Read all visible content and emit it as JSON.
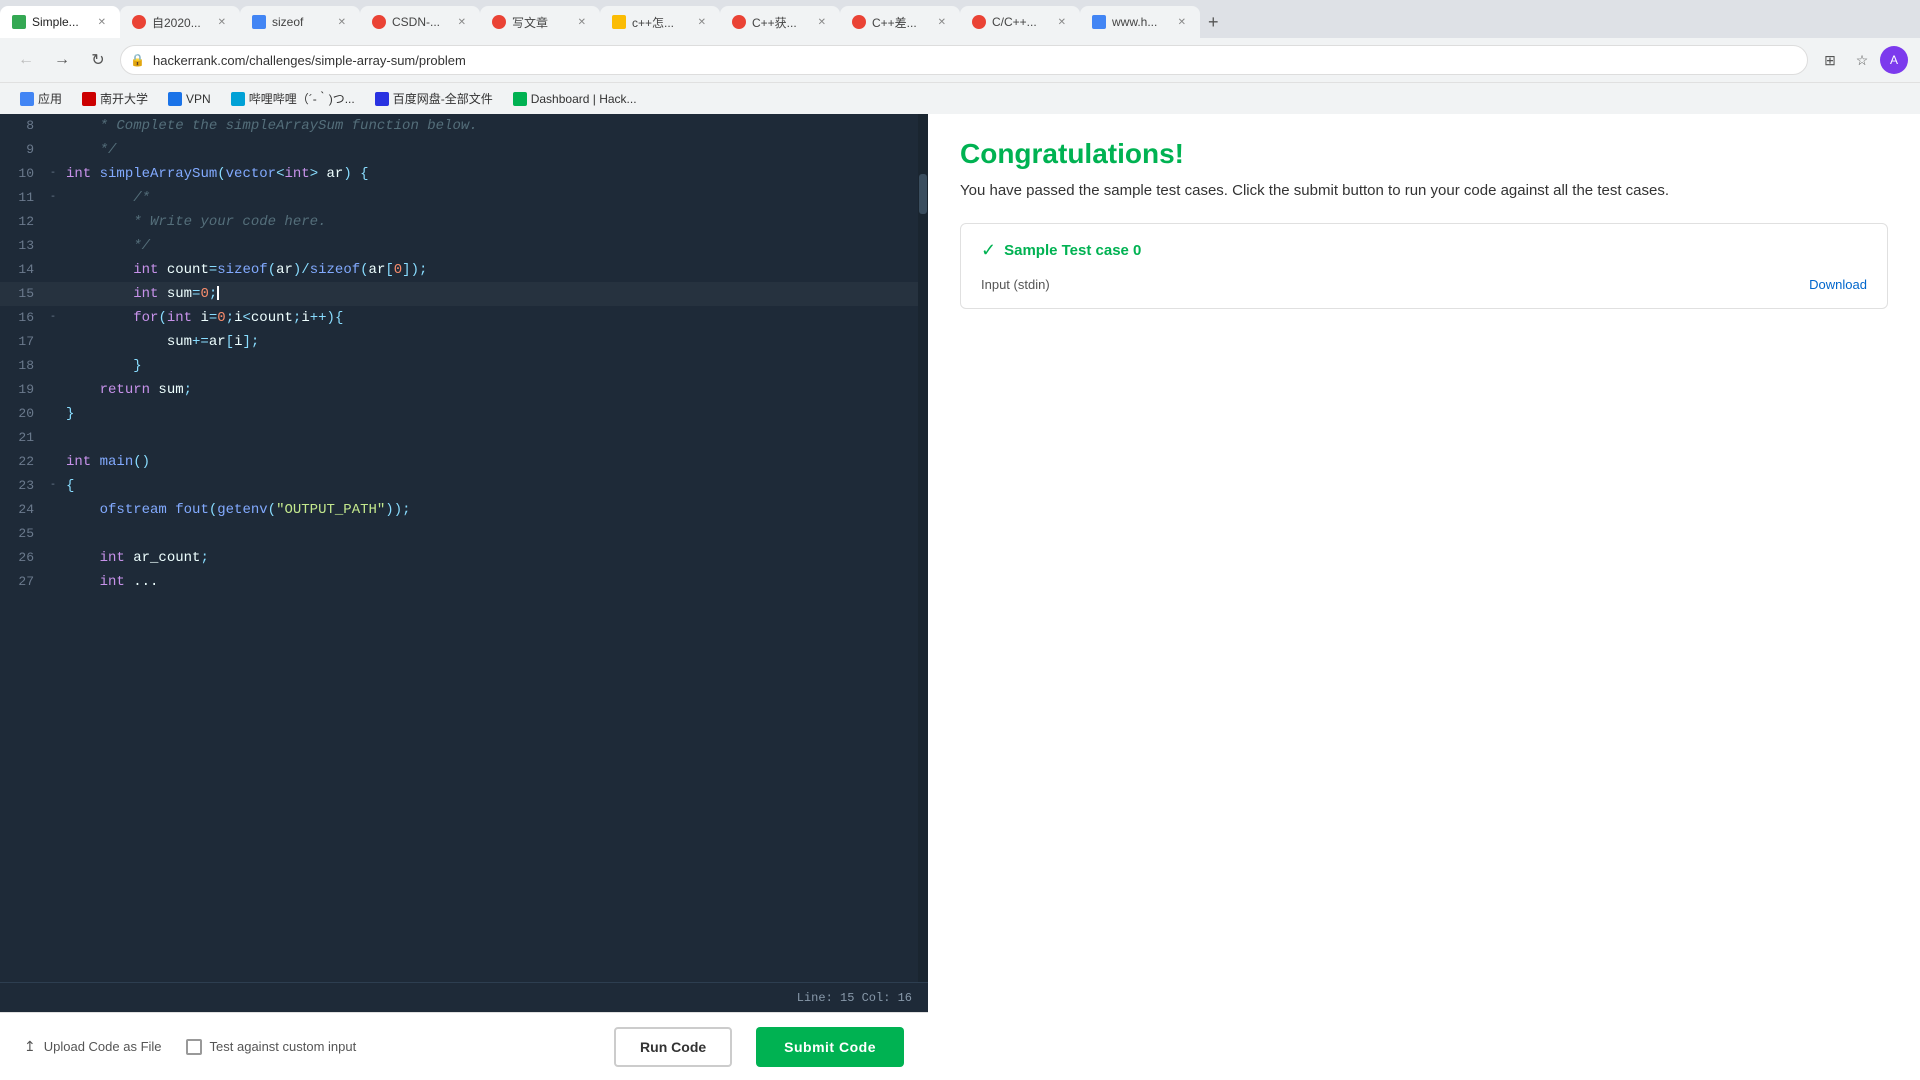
{
  "browser": {
    "tabs": [
      {
        "id": "t1",
        "title": "Simple...",
        "favicon_class": "green",
        "active": true
      },
      {
        "id": "t2",
        "title": "自2020...",
        "favicon_class": "red-c",
        "active": false
      },
      {
        "id": "t3",
        "title": "sizeof",
        "favicon_class": "blue-b",
        "active": false
      },
      {
        "id": "t4",
        "title": "CSDN-...",
        "favicon_class": "red-c",
        "active": false
      },
      {
        "id": "t5",
        "title": "写文章",
        "favicon_class": "red-c",
        "active": false
      },
      {
        "id": "t6",
        "title": "c++怎...",
        "favicon_class": "yellow-b",
        "active": false
      },
      {
        "id": "t7",
        "title": "C++获...",
        "favicon_class": "red-c",
        "active": false
      },
      {
        "id": "t8",
        "title": "C++差...",
        "favicon_class": "red-c",
        "active": false
      },
      {
        "id": "t9",
        "title": "C/C++...",
        "favicon_class": "red-c",
        "active": false
      },
      {
        "id": "t10",
        "title": "www.h...",
        "favicon_class": "blue-b",
        "active": false
      }
    ],
    "address": "hackerrank.com/challenges/simple-array-sum/problem",
    "bookmarks": [
      {
        "label": "应用",
        "favicon_class": "bm-apps"
      },
      {
        "label": "南开大学",
        "favicon_class": "bm-nankai"
      },
      {
        "label": "VPN",
        "favicon_class": "bm-vpn"
      },
      {
        "label": "哔哩哔哩（´-｀)つ...",
        "favicon_class": "bm-bilibili"
      },
      {
        "label": "百度网盘-全部文件",
        "favicon_class": "bm-baidu"
      },
      {
        "label": "Dashboard | Hack...",
        "favicon_class": "bm-hacker"
      }
    ]
  },
  "editor": {
    "lines": [
      {
        "num": 8,
        "fold": null,
        "content": "    * Complete the simpleArraySum function below.",
        "type": "comment"
      },
      {
        "num": 9,
        "fold": null,
        "content": "    */",
        "type": "comment"
      },
      {
        "num": 10,
        "fold": "-",
        "content": "int simpleArraySum(vector<int> ar) {",
        "type": "code"
      },
      {
        "num": 11,
        "fold": "-",
        "content": "    /*",
        "type": "comment"
      },
      {
        "num": 12,
        "fold": null,
        "content": "    * Write your code here.",
        "type": "comment"
      },
      {
        "num": 13,
        "fold": null,
        "content": "    */",
        "type": "comment"
      },
      {
        "num": 14,
        "fold": null,
        "content": "    int count=sizeof(ar)/sizeof(ar[0]);",
        "type": "code"
      },
      {
        "num": 15,
        "fold": null,
        "content": "    int sum=0;",
        "type": "code"
      },
      {
        "num": 16,
        "fold": "-",
        "content": "    for(int i=0;i<count;i++){",
        "type": "code"
      },
      {
        "num": 17,
        "fold": null,
        "content": "        sum+=ar[i];",
        "type": "code"
      },
      {
        "num": 18,
        "fold": null,
        "content": "    }",
        "type": "code"
      },
      {
        "num": 19,
        "fold": null,
        "content": "    return sum;",
        "type": "code"
      },
      {
        "num": 20,
        "fold": null,
        "content": "}",
        "type": "code"
      },
      {
        "num": 21,
        "fold": null,
        "content": "",
        "type": "code"
      },
      {
        "num": 22,
        "fold": null,
        "content": "int main()",
        "type": "code"
      },
      {
        "num": 23,
        "fold": "-",
        "content": "{",
        "type": "code"
      },
      {
        "num": 24,
        "fold": null,
        "content": "    ofstream fout(getenv(\"OUTPUT_PATH\"));",
        "type": "code"
      },
      {
        "num": 25,
        "fold": null,
        "content": "",
        "type": "code"
      },
      {
        "num": 26,
        "fold": null,
        "content": "    int ar_count;",
        "type": "code"
      },
      {
        "num": 27,
        "fold": null,
        "content": "    int ...",
        "type": "code"
      }
    ],
    "status": {
      "line": 15,
      "col": 16,
      "label": "Line: 15 Col: 16"
    }
  },
  "toolbar": {
    "upload_label": "Upload Code as File",
    "custom_input_label": "Test against custom input",
    "run_code_label": "Run Code",
    "submit_code_label": "Submit Code"
  },
  "results": {
    "title": "Congratulations!",
    "message": "You have passed the sample test cases. Click the submit button to run your code against all the test cases.",
    "test_cases": [
      {
        "id": "tc0",
        "title": "Sample Test case 0",
        "input_label": "Input (stdin)",
        "download_label": "Download"
      }
    ]
  }
}
